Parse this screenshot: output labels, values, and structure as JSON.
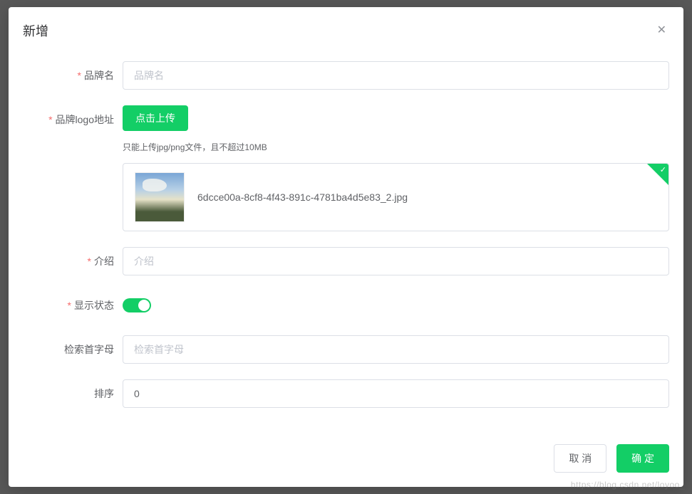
{
  "dialog": {
    "title": "新增",
    "close_label": "✕"
  },
  "form": {
    "brand_name": {
      "label": "品牌名",
      "placeholder": "品牌名",
      "value": ""
    },
    "logo": {
      "label": "品牌logo地址",
      "upload_btn": "点击上传",
      "tip": "只能上传jpg/png文件，且不超过10MB",
      "file_name": "6dcce00a-8cf8-4f43-891c-4781ba4d5e83_2.jpg"
    },
    "intro": {
      "label": "介绍",
      "placeholder": "介绍",
      "value": ""
    },
    "show_status": {
      "label": "显示状态",
      "value": true
    },
    "first_letter": {
      "label": "检索首字母",
      "placeholder": "检索首字母",
      "value": ""
    },
    "sort": {
      "label": "排序",
      "value": "0"
    }
  },
  "footer": {
    "cancel": "取 消",
    "confirm": "确 定"
  },
  "watermark": "https://blog.csdn.net/loyoo_"
}
